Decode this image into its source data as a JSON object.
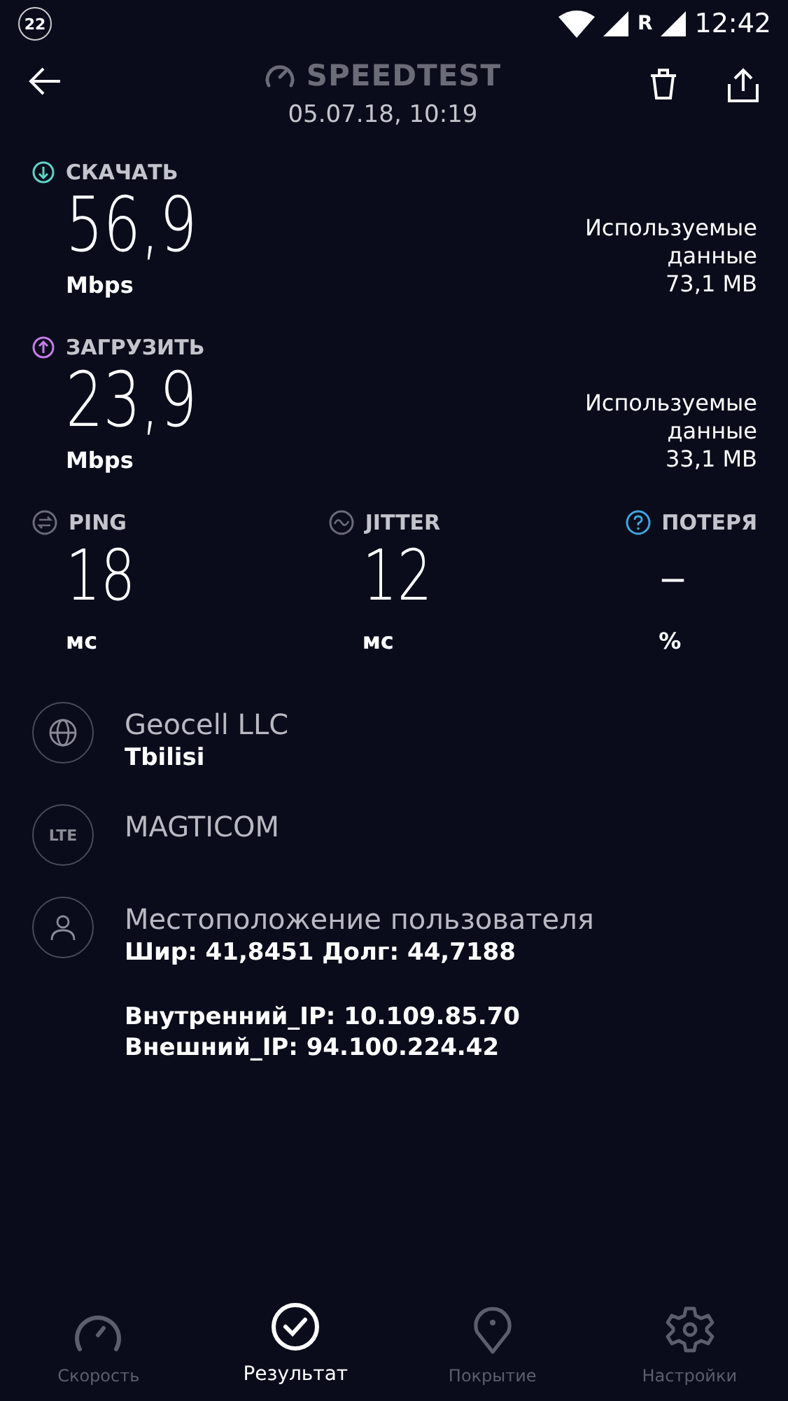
{
  "status_bar": {
    "notification_count": "22",
    "roaming": "R",
    "time": "12:42"
  },
  "header": {
    "title": "SPEEDTEST",
    "date": "05.07.18, 10:19"
  },
  "speeds": [
    {
      "kind": "download",
      "color": "#5fd3c6",
      "label": "СКАЧАТЬ",
      "value": "56,9",
      "unit": "Mbps",
      "data_label": "Используемые данные",
      "data_value": "73,1 MB"
    },
    {
      "kind": "upload",
      "color": "#c57de8",
      "label": "ЗАГРУЗИТЬ",
      "value": "23,9",
      "unit": "Mbps",
      "data_label": "Используемые данные",
      "data_value": "33,1 MB"
    }
  ],
  "metrics": [
    {
      "kind": "ping",
      "label": "PING",
      "value": "18",
      "unit": "мс"
    },
    {
      "kind": "jitter",
      "label": "JITTER",
      "value": "12",
      "unit": "мс"
    },
    {
      "kind": "loss",
      "label": "ПОТЕРЯ",
      "value": "–",
      "unit": "%"
    }
  ],
  "info": [
    {
      "kind": "globe",
      "title": "Geocell LLC",
      "lines": [
        "Tbilisi"
      ]
    },
    {
      "kind": "lte",
      "badge": "LTE",
      "title": "MAGTICOM"
    },
    {
      "kind": "user",
      "title": "Местоположение пользователя",
      "lines": [
        "Шир: 41,8451 Долг: 44,7188"
      ],
      "extra": [
        "Внутренний_IP: 10.109.85.70",
        "Внешний_IP: 94.100.224.42"
      ]
    }
  ],
  "nav": [
    {
      "kind": "speed",
      "label": "Скорость",
      "selected": false
    },
    {
      "kind": "results",
      "label": "Результат",
      "selected": true
    },
    {
      "kind": "coverage",
      "label": "Покрытие",
      "selected": false
    },
    {
      "kind": "settings",
      "label": "Настройки",
      "selected": false
    }
  ]
}
